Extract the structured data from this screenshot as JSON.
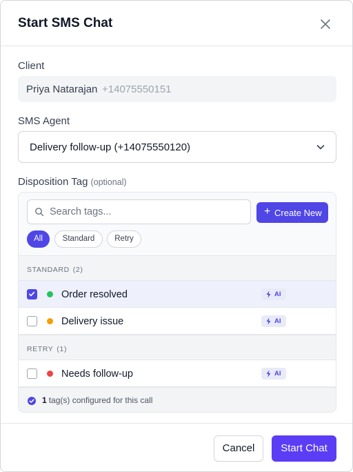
{
  "dialog": {
    "title": "Start SMS Chat",
    "close_icon": "close-icon"
  },
  "client": {
    "label": "Client",
    "name": "Priya Natarajan",
    "phone": "+14075550151"
  },
  "agent": {
    "label": "SMS Agent",
    "value": "Delivery follow-up (+14075550120)"
  },
  "disposition": {
    "label": "Disposition Tag",
    "optional": "(optional)",
    "search": {
      "placeholder": "Search tags..."
    },
    "create_label": "Create New",
    "filters": [
      {
        "label": "All",
        "active": true
      },
      {
        "label": "Standard",
        "active": false
      },
      {
        "label": "Retry",
        "active": false
      }
    ],
    "sections": [
      {
        "title": "STANDARD",
        "count": "(2)",
        "tags": [
          {
            "name": "Order resolved",
            "color": "#22c55e",
            "checked": true,
            "badge": "AI"
          },
          {
            "name": "Delivery issue",
            "color": "#f59e0b",
            "checked": false,
            "badge": "AI"
          }
        ]
      },
      {
        "title": "RETRY",
        "count": "(1)",
        "tags": [
          {
            "name": "Needs follow-up",
            "color": "#ef4444",
            "checked": false,
            "badge": "AI"
          }
        ]
      }
    ],
    "summary": {
      "count": "1",
      "text": "tag(s) configured for this call"
    }
  },
  "actions": {
    "cancel": "Cancel",
    "start": "Start Chat"
  },
  "colors": {
    "accent": "#4f46e5",
    "start_button": "#5b3df5"
  }
}
